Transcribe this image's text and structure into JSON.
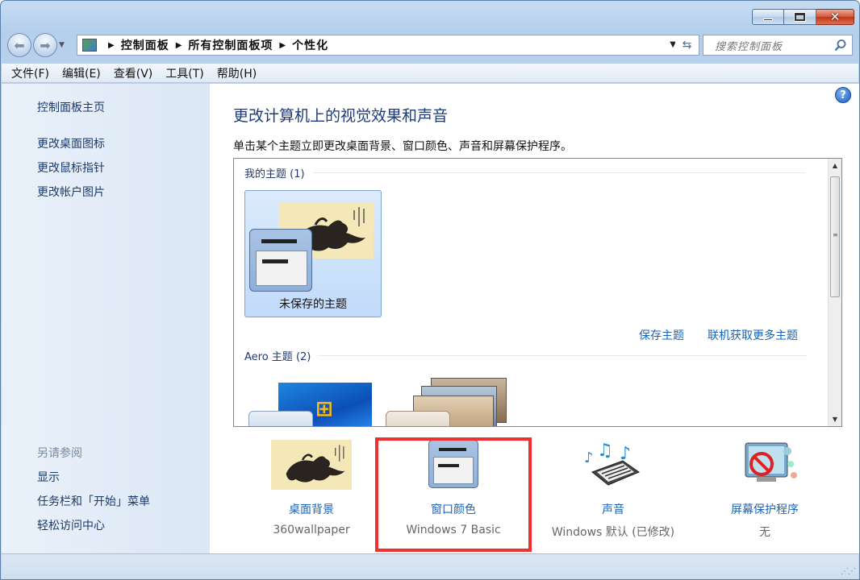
{
  "nav": {
    "breadcrumbs": [
      "控制面板",
      "所有控制面板项",
      "个性化"
    ],
    "search_placeholder": "搜索控制面板"
  },
  "menu": [
    "文件(F)",
    "编辑(E)",
    "查看(V)",
    "工具(T)",
    "帮助(H)"
  ],
  "sidebar": {
    "home": "控制面板主页",
    "links": [
      "更改桌面图标",
      "更改鼠标指针",
      "更改帐户图片"
    ],
    "see_also_title": "另请参阅",
    "see_also": [
      "显示",
      "任务栏和「开始」菜单",
      "轻松访问中心"
    ]
  },
  "main": {
    "title": "更改计算机上的视觉效果和声音",
    "description": "单击某个主题立即更改桌面背景、窗口颜色、声音和屏幕保护程序。",
    "my_themes_header": "我的主题 (1)",
    "unsaved_theme": "未保存的主题",
    "save_theme": "保存主题",
    "get_more_themes": "联机获取更多主题",
    "aero_header": "Aero 主题 (2)",
    "help_glyph": "?"
  },
  "options": [
    {
      "label": "桌面背景",
      "value": "360wallpaper"
    },
    {
      "label": "窗口颜色",
      "value": "Windows 7 Basic"
    },
    {
      "label": "声音",
      "value": "Windows 默认 (已修改)"
    },
    {
      "label": "屏幕保护程序",
      "value": "无"
    }
  ],
  "colors": {
    "highlight": "#f03030",
    "link": "#1b63b7",
    "title": "#1e3a78"
  }
}
